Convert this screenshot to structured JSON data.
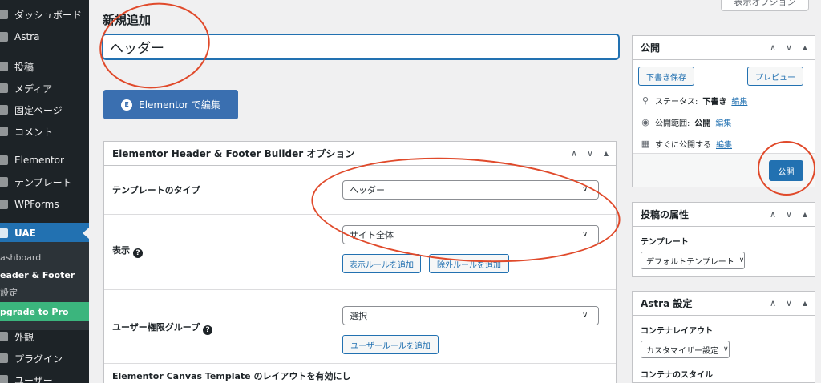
{
  "sidebar": {
    "items": [
      {
        "label": "ダッシュボード",
        "icon": "dashboard-icon"
      },
      {
        "label": "Astra",
        "icon": "astra-icon"
      },
      {
        "label": "投稿",
        "icon": "posts-icon"
      },
      {
        "label": "メディア",
        "icon": "media-icon"
      },
      {
        "label": "固定ページ",
        "icon": "pages-icon"
      },
      {
        "label": "コメント",
        "icon": "comments-icon"
      },
      {
        "label": "Elementor",
        "icon": "elementor-icon"
      },
      {
        "label": "テンプレート",
        "icon": "templates-icon"
      },
      {
        "label": "WPForms",
        "icon": "wpforms-icon"
      },
      {
        "label": "UAE",
        "icon": "uae-icon"
      },
      {
        "label": "外観",
        "icon": "appearance-icon"
      },
      {
        "label": "プラグイン",
        "icon": "plugins-icon"
      },
      {
        "label": "ユーザー",
        "icon": "users-icon"
      }
    ],
    "submenu": [
      {
        "label": "ashboard"
      },
      {
        "label": "eader & Footer"
      },
      {
        "label": "設定"
      },
      {
        "label": "pgrade to Pro"
      }
    ]
  },
  "screen_options": {
    "label": "表示オプション"
  },
  "page_title": "新規追加",
  "title_input": {
    "value": "ヘッダー"
  },
  "elementor_button": {
    "label": "Elementor で編集",
    "logo": "E"
  },
  "hf_box": {
    "title": "Elementor Header & Footer Builder オプション",
    "template_type": {
      "label": "テンプレートのタイプ",
      "value": "ヘッダー"
    },
    "display": {
      "label": "表示",
      "value": "サイト全体",
      "add_rule": "表示ルールを追加",
      "exclude_rule": "除外ルールを追加"
    },
    "user_roles": {
      "label": "ユーザー権限グループ",
      "value": "選択",
      "add_rule": "ユーザールールを追加"
    },
    "canvas": {
      "label": "Elementor Canvas Template のレイアウトを有効にし"
    }
  },
  "publish_box": {
    "title": "公開",
    "save_draft": "下書き保存",
    "preview": "プレビュー",
    "status_label": "ステータス:",
    "status_value": "下書き",
    "visibility_label": "公開範囲:",
    "visibility_value": "公開",
    "schedule_label": "すぐに公開する",
    "edit_link": "編集",
    "publish_button": "公開"
  },
  "attributes_box": {
    "title": "投稿の属性",
    "template_label": "テンプレート",
    "template_value": "デフォルトテンプレート"
  },
  "astra_box": {
    "title": "Astra 設定",
    "container_label": "コンテナレイアウト",
    "container_value": "カスタマイザー設定",
    "style_label": "コンテナのスタイル"
  },
  "box_controls": {
    "up": "∧",
    "down": "∨",
    "toggle": "▲"
  },
  "colors": {
    "accent": "#2271b1",
    "sidebar_bg": "#1d2327",
    "upgrade_green": "#3bb57d",
    "annotation_red": "#e04a2b"
  }
}
